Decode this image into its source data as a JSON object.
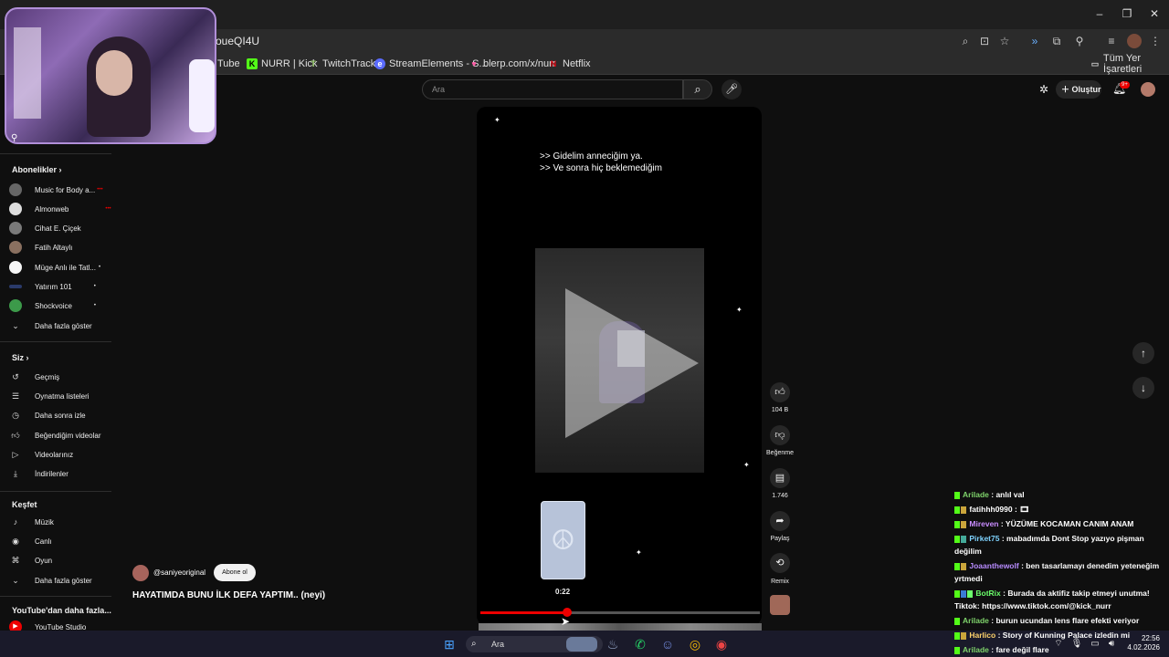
{
  "browser": {
    "url_fragment": "oueQI4U",
    "bookmarks": [
      {
        "label": "Tube"
      },
      {
        "label": "NURR | Kick"
      },
      {
        "label": "TwitchTracker"
      },
      {
        "label": "StreamElements - S..."
      },
      {
        "label": "blerp.com/x/nurr"
      },
      {
        "label": "Netflix"
      }
    ],
    "all_bookmarks": "Tüm Yer İşaretleri"
  },
  "header": {
    "search_placeholder": "Ara",
    "create_label": "Oluştur",
    "notif_count": "9+"
  },
  "sidebar": {
    "subscriptions_title": "Abonelikler",
    "subscriptions": [
      {
        "label": "Music for Body a..."
      },
      {
        "label": "Almonweb"
      },
      {
        "label": "Cihat E. Çiçek"
      },
      {
        "label": "Fatih Altaylı"
      },
      {
        "label": "Müge Anlı ile Tatl..."
      },
      {
        "label": "Yatırım 101"
      },
      {
        "label": "Shockvoice"
      },
      {
        "label": "Daha fazla göster"
      }
    ],
    "you_title": "Siz",
    "you_items": [
      {
        "label": "Geçmiş"
      },
      {
        "label": "Oynatma listeleri"
      },
      {
        "label": "Daha sonra izle"
      },
      {
        "label": "Beğendiğim videolar"
      },
      {
        "label": "Videolarınız"
      },
      {
        "label": "İndirilenler"
      }
    ],
    "explore_title": "Keşfet",
    "explore_items": [
      {
        "label": "Müzik"
      },
      {
        "label": "Canlı"
      },
      {
        "label": "Oyun"
      },
      {
        "label": "Daha fazla göster"
      }
    ],
    "more_title": "YouTube'dan daha fazla...",
    "more_items": [
      {
        "label": "YouTube Studio"
      }
    ]
  },
  "player": {
    "subtitle_line1": ">> Gidelim anneciğim ya.",
    "subtitle_line2": ">> Ve sonra hiç beklemediğim",
    "preview_time": "0:22",
    "progress_fraction": 0.31
  },
  "actions": {
    "likes": "104 B",
    "dislike_label": "Beğenme",
    "comments": "1.746",
    "share_label": "Paylaş",
    "remix_label": "Remix"
  },
  "channel": {
    "handle": "@saniyeoriginal",
    "subscribe_label": "Abone ol",
    "video_title": "HAYATIMDA BUNU İLK DEFA YAPTIM.. (neyi)"
  },
  "chat": [
    {
      "user": "Arilade",
      "msg": ": anlıl val",
      "color": "#7fd36b"
    },
    {
      "user": "fatihhh0990",
      "msg": ": 🎞",
      "color": "#ffffff"
    },
    {
      "user": "Mireven",
      "msg": ": YÜZÜME KOCAMAN CANIM ANAM",
      "color": "#c98cff"
    },
    {
      "user": "Pirket75",
      "msg": ": mabadımda Dont Stop yazıyo pişman değilim",
      "color": "#7fd3ff"
    },
    {
      "user": "Joaanthewolf",
      "msg": ": ben tasarlamayı denedim yeteneğim yrtmedi",
      "color": "#b88cff"
    },
    {
      "user": "BotRix",
      "msg": ": Burada da aktifiz takip etmeyi unutma! Tiktok: https://www.tiktok.com/@kick_nurr",
      "color": "#6bff6b"
    },
    {
      "user": "Arilade",
      "msg": ": burun ucundan lens flare efekti veriyor",
      "color": "#7fd36b"
    },
    {
      "user": "Harlico",
      "msg": ": Story of Kunning Palace izledin mi",
      "color": "#ffd36b"
    },
    {
      "user": "Arilade",
      "msg": ": fare değil flare",
      "color": "#7fd36b"
    }
  ],
  "taskbar": {
    "search_label": "Ara",
    "time": "22:56",
    "date": "4.02.2026"
  },
  "colors": {
    "accent_red": "#ff0000",
    "background": "#0f0f0f"
  }
}
